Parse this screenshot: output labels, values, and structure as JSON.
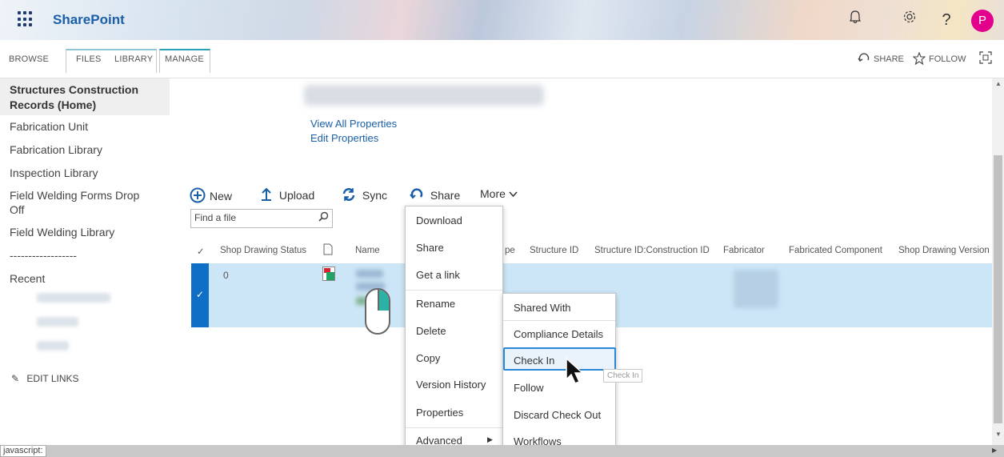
{
  "suitebar": {
    "app_name": "SharePoint",
    "avatar_initial": "P",
    "icons": [
      "waffle-icon",
      "bell-icon",
      "gear-icon",
      "help-icon"
    ]
  },
  "ribbon": {
    "tabs": [
      "BROWSE",
      "FILES",
      "LIBRARY",
      "MANAGE"
    ],
    "share_label": "SHARE",
    "follow_label": "FOLLOW"
  },
  "leftnav": {
    "home": "Structures Construction Records (Home)",
    "items": [
      "Fabrication Unit",
      "Fabrication Library",
      "Inspection Library",
      "Field Welding Forms Drop Off",
      "Field Welding Library"
    ],
    "separator": "------------------",
    "recent": "Recent",
    "edit_links": "EDIT LINKS"
  },
  "content": {
    "view_all_properties": "View All Properties",
    "edit_properties": "Edit Properties",
    "commands": {
      "new": "New",
      "upload": "Upload",
      "sync": "Sync",
      "share": "Share",
      "more": "More"
    },
    "search_placeholder": "Find a file",
    "columns": {
      "check": "✓",
      "shop_drawing_status": "Shop Drawing Status",
      "name": "Name",
      "type_partial": "pe",
      "structure_id": "Structure ID",
      "structure_construction_id": "Structure ID:Construction ID",
      "fabricator": "Fabricator",
      "fabricated_component": "Fabricated Component",
      "shop_drawing_version": "Shop Drawing Version"
    },
    "row": {
      "shop_drawing_status": "0",
      "selected": true
    }
  },
  "context_menu": {
    "items": [
      "Download",
      "Share",
      "Get a link",
      "Rename",
      "Delete",
      "Copy",
      "Version History",
      "Properties",
      "Advanced"
    ]
  },
  "submenu": {
    "items": [
      "Shared With",
      "Compliance Details",
      "Check In",
      "Follow",
      "Discard Check Out",
      "Workflows"
    ],
    "highlighted": "Check In"
  },
  "tooltip": "Check In",
  "statusbar": "javascript:",
  "colors": {
    "brand": "#1a5fa8",
    "selected_row": "#cde6f7",
    "selection_bar": "#0f6fc6",
    "avatar": "#e3008c",
    "highlight_border": "#2b88d8"
  }
}
